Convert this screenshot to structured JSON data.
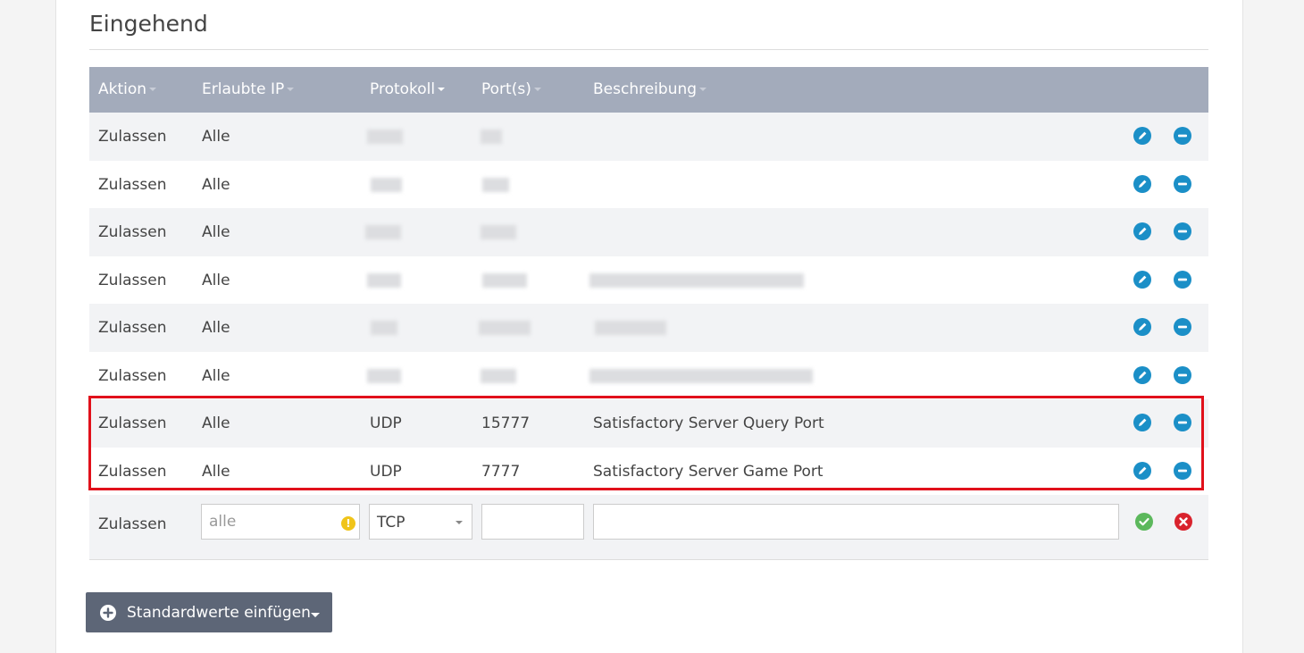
{
  "section": {
    "title": "Eingehend"
  },
  "columns": {
    "action": "Aktion",
    "allowed_ip": "Erlaubte IP",
    "protocol": "Protokoll",
    "ports": "Port(s)",
    "description": "Beschreibung"
  },
  "rows": [
    {
      "action": "Zulassen",
      "ip": "Alle",
      "protocol": "",
      "port": "",
      "description": ""
    },
    {
      "action": "Zulassen",
      "ip": "Alle",
      "protocol": "",
      "port": "",
      "description": ""
    },
    {
      "action": "Zulassen",
      "ip": "Alle",
      "protocol": "",
      "port": "",
      "description": ""
    },
    {
      "action": "Zulassen",
      "ip": "Alle",
      "protocol": "",
      "port": "",
      "description": ""
    },
    {
      "action": "Zulassen",
      "ip": "Alle",
      "protocol": "",
      "port": "",
      "description": ""
    },
    {
      "action": "Zulassen",
      "ip": "Alle",
      "protocol": "",
      "port": "",
      "description": ""
    },
    {
      "action": "Zulassen",
      "ip": "Alle",
      "protocol": "UDP",
      "port": "15777",
      "description": "Satisfactory Server Query Port"
    },
    {
      "action": "Zulassen",
      "ip": "Alle",
      "protocol": "UDP",
      "port": "7777",
      "description": "Satisfactory Server Game Port"
    }
  ],
  "new_row": {
    "action": "Zulassen",
    "ip_placeholder": "alle",
    "protocol_selected": "TCP",
    "port_value": "",
    "description_value": ""
  },
  "defaults_button": {
    "label": "Standardwerte einfügen"
  },
  "colors": {
    "header_bg": "#a3abbb",
    "accent_blue": "#1b8fc7",
    "confirm_green": "#5cb85c",
    "cancel_red": "#d9232d",
    "highlight_red": "#e1111b",
    "button_bg": "#5d6677"
  }
}
